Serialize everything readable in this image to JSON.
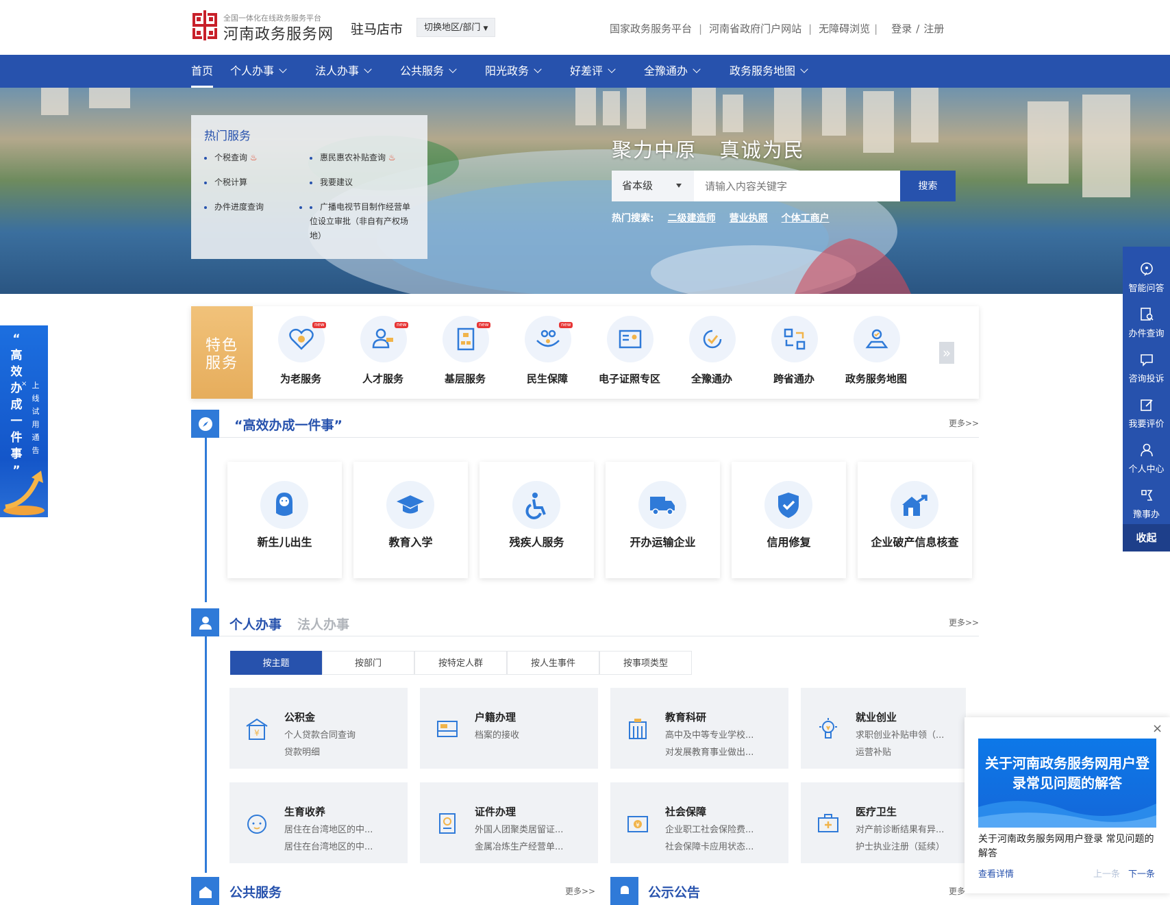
{
  "header": {
    "logo_small": "全国一体化在线政务服务平台",
    "logo_name": "河南政务服务网",
    "city": "驻马店市",
    "switch_label": "切换地区/部门",
    "links": [
      "国家政务服务平台",
      "河南省政府门户网站",
      "无障碍浏览"
    ],
    "login": "登录",
    "register": "注册",
    "sep_pipe": "|",
    "sep_slash": "/"
  },
  "nav": {
    "items": [
      "首页",
      "个人办事",
      "法人办事",
      "公共服务",
      "阳光政务",
      "好差评",
      "全豫通办",
      "政务服务地图"
    ]
  },
  "hot_services": {
    "title": "热门服务",
    "items": [
      "个税查询",
      "惠民惠农补贴查询",
      "个税计算",
      "我要建议",
      "办件进度查询",
      "广播电视节目制作经营单位设立审批（非自有产权场地）"
    ]
  },
  "hero": {
    "slogan": "聚力中原   真诚为民",
    "search_level": "省本级",
    "search_placeholder": "请输入内容关键字",
    "search_button": "搜索",
    "hot_label": "热门搜索:",
    "hot_keywords": [
      "二级建造师",
      "营业执照",
      "个体工商户"
    ]
  },
  "special": {
    "label_line1": "特色",
    "label_line2": "服务",
    "new_tag": "new",
    "items": [
      "为老服务",
      "人才服务",
      "基层服务",
      "民生保障",
      "电子证照专区",
      "全豫通办",
      "跨省通办",
      "政务服务地图"
    ]
  },
  "efficient": {
    "title": "“高效办成一件事”",
    "more": "更多>>",
    "items": [
      "新生儿出生",
      "教育入学",
      "残疾人服务",
      "开办运输企业",
      "信用修复",
      "企业破产信息核查"
    ]
  },
  "affairs": {
    "tab_personal": "个人办事",
    "tab_legal": "法人办事",
    "more": "更多>>",
    "filters": [
      "按主题",
      "按部门",
      "按特定人群",
      "按人生事件",
      "按事项类型"
    ],
    "topics": [
      {
        "title": "公积金",
        "l1": "个人贷款合同查询",
        "l2": "贷款明细"
      },
      {
        "title": "户籍办理",
        "l1": "档案的接收",
        "l2": ""
      },
      {
        "title": "教育科研",
        "l1": "高中及中等专业学校...",
        "l2": "对发展教育事业做出..."
      },
      {
        "title": "就业创业",
        "l1": "求职创业补贴申领（...",
        "l2": "运营补贴"
      },
      {
        "title": "生育收养",
        "l1": "居住在台湾地区的中...",
        "l2": "居住在台湾地区的中..."
      },
      {
        "title": "证件办理",
        "l1": "外国人团聚类居留证...",
        "l2": "金属冶炼生产经营单..."
      },
      {
        "title": "社会保障",
        "l1": "企业职工社会保险费...",
        "l2": "社会保障卡应用状态..."
      },
      {
        "title": "医疗卫生",
        "l1": "对产前诊断结果有异...",
        "l2": "护士执业注册（延续）"
      }
    ]
  },
  "bottom": {
    "public_title": "公共服务",
    "public_more": "更多>>",
    "notice_title": "公示公告",
    "notice_more": "更多"
  },
  "rightbar": {
    "items": [
      "智能问答",
      "办件查询",
      "咨询投诉",
      "我要评价",
      "个人中心",
      "豫事办"
    ],
    "collapse": "收起"
  },
  "leftbanner": {
    "big": [
      "“",
      "高",
      "效",
      "办",
      "成",
      "一",
      "件",
      "事",
      "”"
    ],
    "small": [
      "上",
      "线",
      "试",
      "用",
      "通",
      "告"
    ],
    "close": "×"
  },
  "popup": {
    "close": "×",
    "image_text": "关于河南政务服务网用户登录常见问题的解答",
    "text": "关于河南政务服务网用户登录 常见问题的解答",
    "detail": "查看详情",
    "prev": "上一条",
    "next": "下一条"
  },
  "colors": {
    "primary": "#2752ad",
    "accent": "#2f7ad8",
    "gold": "#e9b265"
  }
}
